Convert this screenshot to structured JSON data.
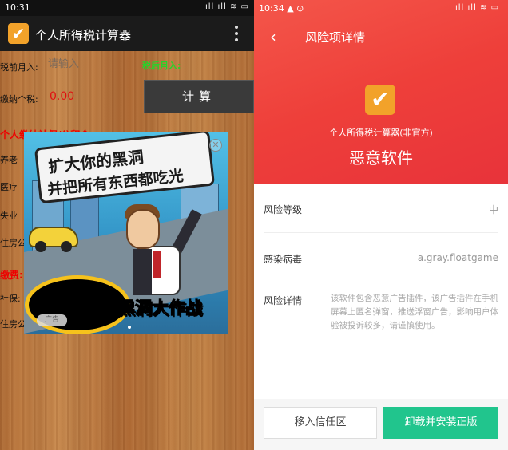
{
  "left": {
    "status": {
      "time": "10:31",
      "icons": "ıll ıll ≋ ▭"
    },
    "app_title": "个人所得税计算器",
    "pre_tax_label": "税前月入:",
    "pre_tax_placeholder": "请输入",
    "after_tax_label": "税后月入:",
    "tax_label": "缴纳个税:",
    "tax_value": "0.00",
    "calc_button": "计算",
    "personal_heading": "个人缴纳社保/公积金",
    "employer_heading": "缴费:",
    "insurance_labels": [
      "养老",
      "医疗",
      "失业",
      "住房公"
    ],
    "base_labels": [
      "社保:",
      "住房公"
    ],
    "ad": {
      "line1": "扩大你的黑洞",
      "line2": "并把所有东西都吃光",
      "game_title": "黑洞大作战",
      "tag": "广告",
      "close": "✕"
    }
  },
  "right": {
    "status": {
      "time": "10:34",
      "alerts": "▲ ⊙",
      "icons": "ıll ıll ≋ ▭"
    },
    "back": "‹",
    "title": "风险项详情",
    "app_name": "个人所得税计算器(非官方)",
    "verdict": "恶意软件",
    "rows": [
      {
        "key": "风险等级",
        "value": "中"
      },
      {
        "key": "感染病毒",
        "value": "a.gray.floatgame"
      }
    ],
    "detail_key": "风险详情",
    "detail_text": "该软件包含恶意广告插件，该广告插件在手机屏幕上匿名弹窗，推送浮窗广告，影响用户体验被投诉较多，请谨慎使用。",
    "trust_button": "移入信任区",
    "uninstall_button": "卸载并安装正版"
  }
}
